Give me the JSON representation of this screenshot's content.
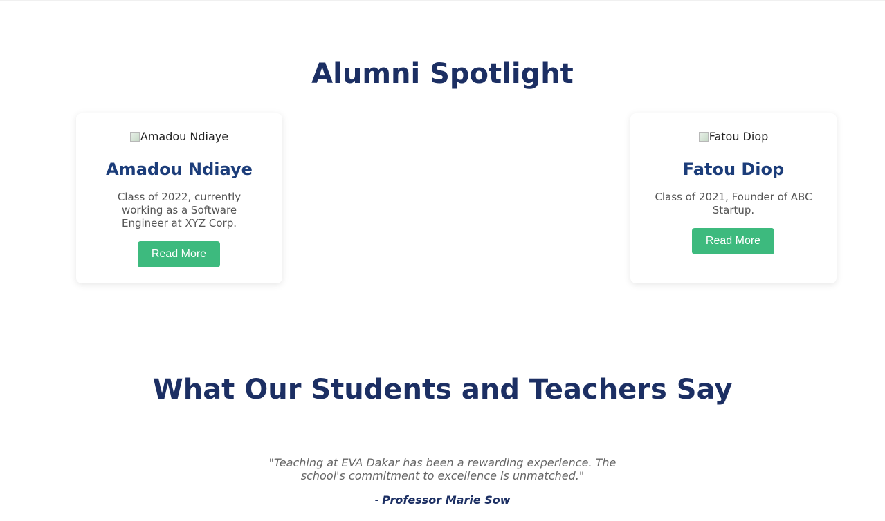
{
  "alumni": {
    "title": "Alumni Spotlight",
    "cards": [
      {
        "image_alt": "Amadou Ndiaye",
        "name": "Amadou Ndiaye",
        "description": "Class of 2022, currently working as a Software Engineer at XYZ Corp.",
        "button_label": "Read More"
      },
      {
        "image_alt": "Fatou Diop",
        "name": "Fatou Diop",
        "description": "Class of 2021, Founder of ABC Startup.",
        "button_label": "Read More"
      }
    ]
  },
  "testimonials": {
    "title": "What Our Students and Teachers Say",
    "quote": "\"Teaching at EVA Dakar has been a rewarding experience. The school's commitment to excellence is unmatched.\"",
    "author_prefix": "- ",
    "author": "Professor Marie Sow"
  },
  "colors": {
    "heading": "#1c2f63",
    "card_name": "#1c3d7a",
    "button": "#3dba7e",
    "body_text": "#555555"
  }
}
